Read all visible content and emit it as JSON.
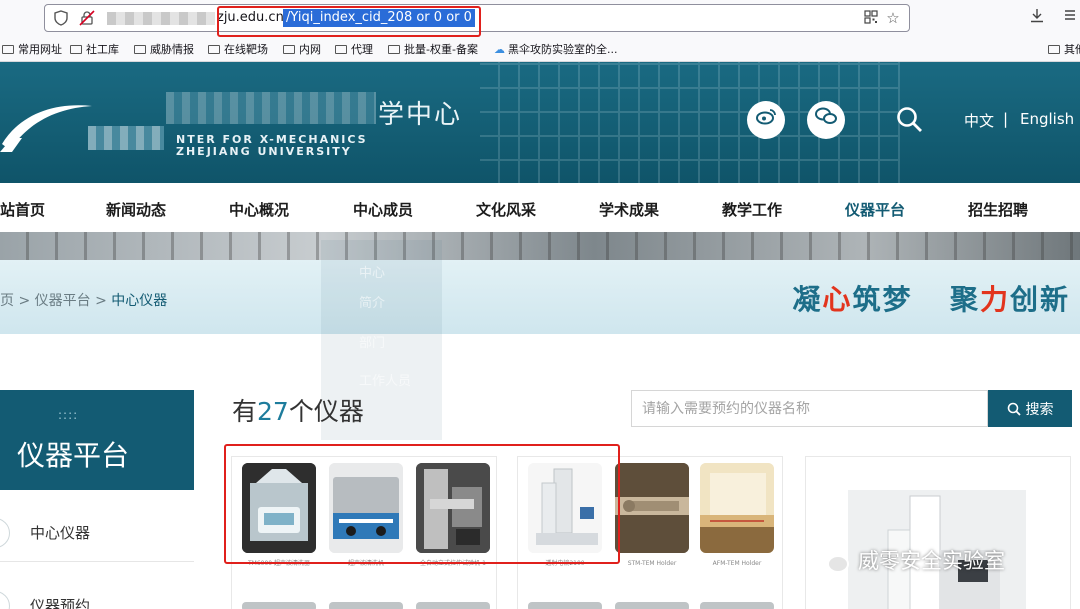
{
  "browser": {
    "url_host": "zju.edu.cn",
    "url_path": "/Yiqi_index_cid_208 or 0 or 0",
    "bookmarks": [
      "常用网址",
      "社工库",
      "威胁情报",
      "在线靶场",
      "内网",
      "代理",
      "批量-权重-备案",
      "黑伞攻防实验室的全...",
      "其他书"
    ]
  },
  "header": {
    "logo_en_line1": "NTER FOR X-MECHANICS",
    "logo_en_line2": "ZHEJIANG UNIVERSITY",
    "logo_cn_tail": "学中心",
    "weibo_glyph": "微",
    "lang_cn": "中文",
    "lang_sep": "|",
    "lang_en": "English"
  },
  "nav": {
    "items": [
      {
        "label": "站首页"
      },
      {
        "label": "新闻动态"
      },
      {
        "label": "中心概况"
      },
      {
        "label": "中心成员"
      },
      {
        "label": "文化风采"
      },
      {
        "label": "学术成果"
      },
      {
        "label": "教学工作"
      },
      {
        "label": "仪器平台",
        "active": true
      },
      {
        "label": "招生招聘"
      }
    ]
  },
  "banner": {
    "breadcrumb_home": "页",
    "breadcrumb_sep": ">",
    "breadcrumb_mid": "仪器平台",
    "breadcrumb_current": "中心仪器",
    "slogan_a": "凝",
    "slogan_b": "心",
    "slogan_c": "筑梦",
    "slogan_d": "聚",
    "slogan_e": "力",
    "slogan_f": "创新",
    "ghost_items": [
      "中心",
      "简介",
      "部门",
      "工作人员"
    ]
  },
  "sidebar": {
    "dots": "::::",
    "title": "仪器平台",
    "items": [
      {
        "label": "中心仪器"
      },
      {
        "label": "仪器预约"
      }
    ]
  },
  "main": {
    "count_prefix": "有",
    "count": "27",
    "count_suffix": "个仪器",
    "search_placeholder": "请输入需要预约的仪器名称",
    "search_button": "搜索"
  },
  "cards": {
    "captions": [
      "TM6000 超声波清洗器",
      "超声波清洗机",
      "全自动立式拉伸试验机-1",
      "透射电镜2100",
      "STM-TEM Holder",
      "AFM-TEM Holder"
    ]
  },
  "watermark": {
    "text": "威零安全实验室"
  }
}
